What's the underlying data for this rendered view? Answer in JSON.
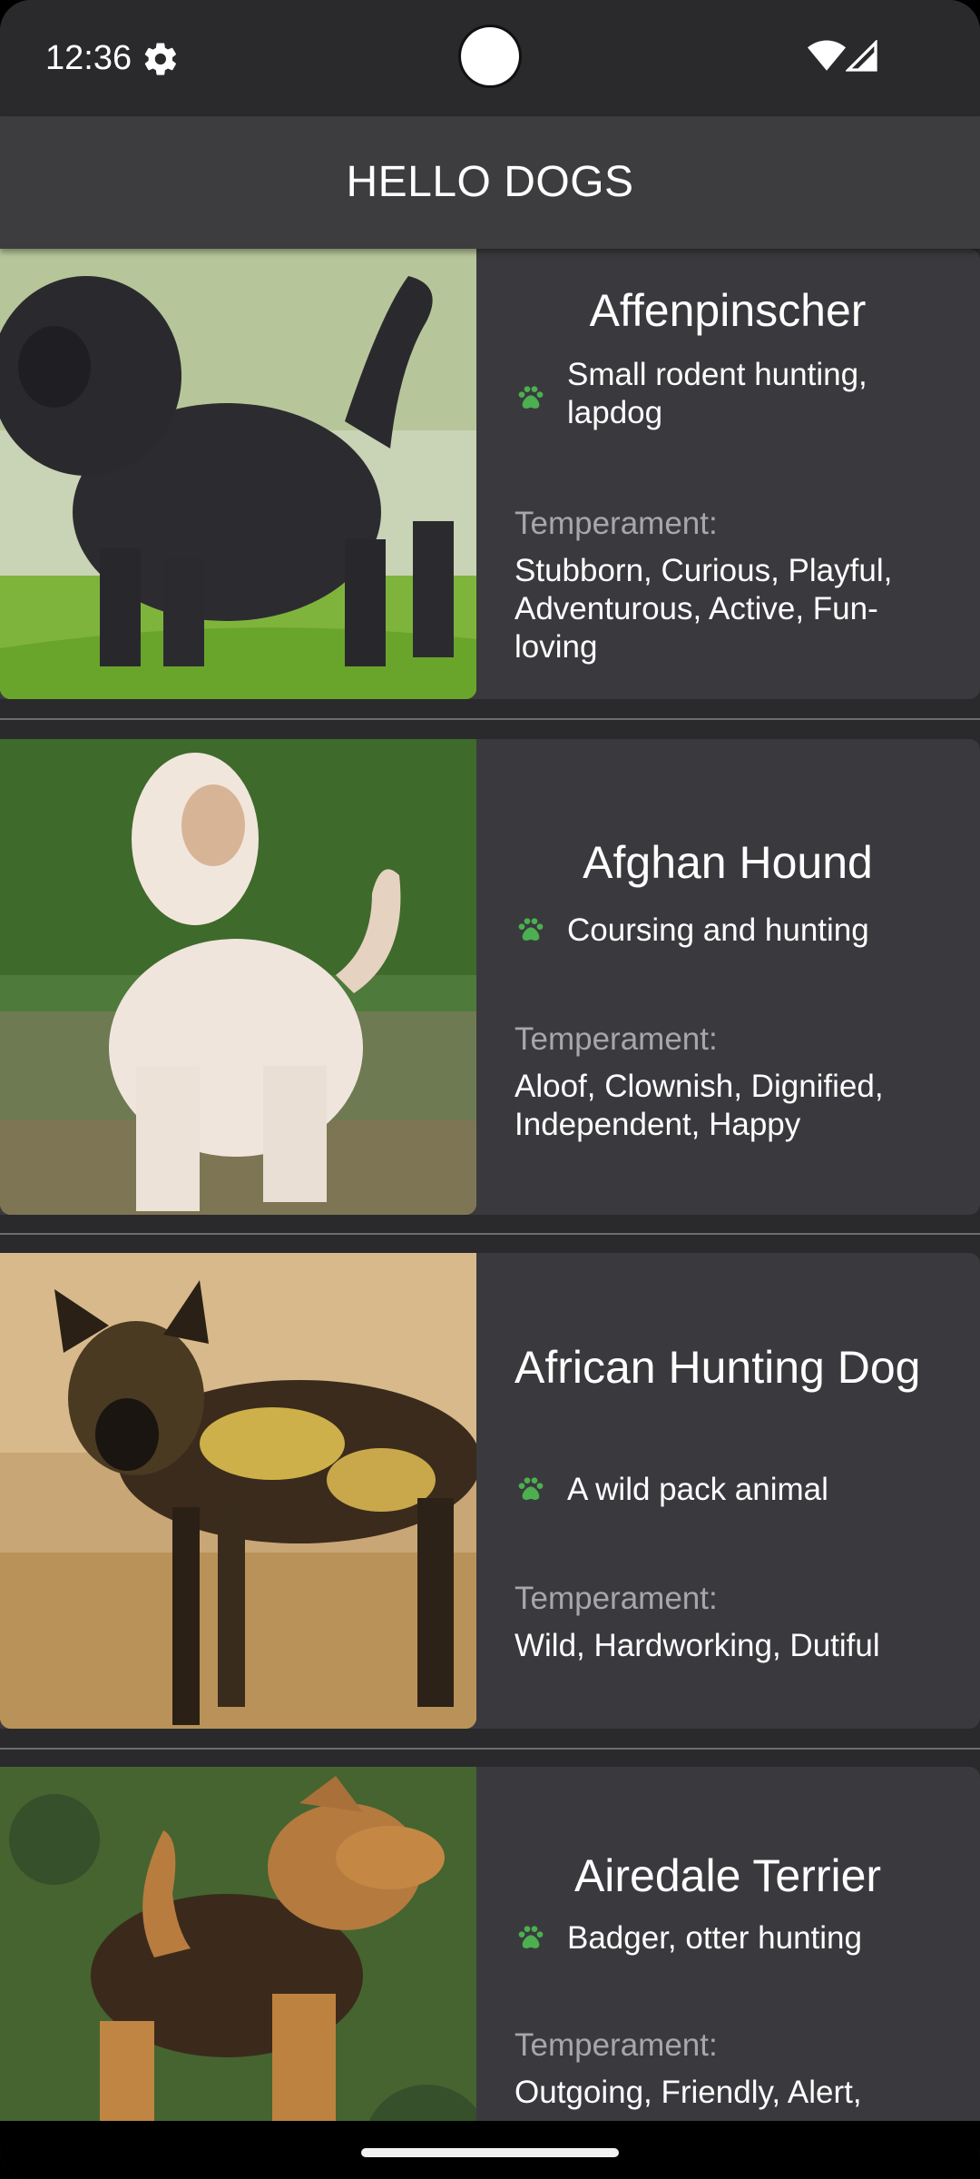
{
  "status_bar": {
    "time": "12:36",
    "icons": [
      "gear-icon",
      "wifi-icon",
      "signal-icon"
    ]
  },
  "app_bar": {
    "title": "HELLO DOGS"
  },
  "colors": {
    "background": "#2a2a2c",
    "app_bar": "#3d3d3f",
    "card": "#3a3a3e",
    "paw_accent": "#4caf50",
    "label_gray": "#a7a7aa"
  },
  "dogs": [
    {
      "name": "Affenpinscher",
      "bred_for": "Small rodent hunting, lapdog",
      "temperament_label": "Temperament:",
      "temperament": "Stubborn, Curious, Playful, Adventurous, Active, Fun-loving",
      "icon": "paw-icon"
    },
    {
      "name": "Afghan Hound",
      "bred_for": "Coursing and hunting",
      "temperament_label": "Temperament:",
      "temperament": "Aloof, Clownish, Dignified, Independent, Happy",
      "icon": "paw-icon"
    },
    {
      "name": "African Hunting Dog",
      "bred_for": "A wild pack animal",
      "temperament_label": "Temperament:",
      "temperament": "Wild, Hardworking, Dutiful",
      "icon": "paw-icon"
    },
    {
      "name": "Airedale Terrier",
      "bred_for": "Badger, otter hunting",
      "temperament_label": "Temperament:",
      "temperament": "Outgoing, Friendly, Alert,",
      "icon": "paw-icon"
    }
  ]
}
